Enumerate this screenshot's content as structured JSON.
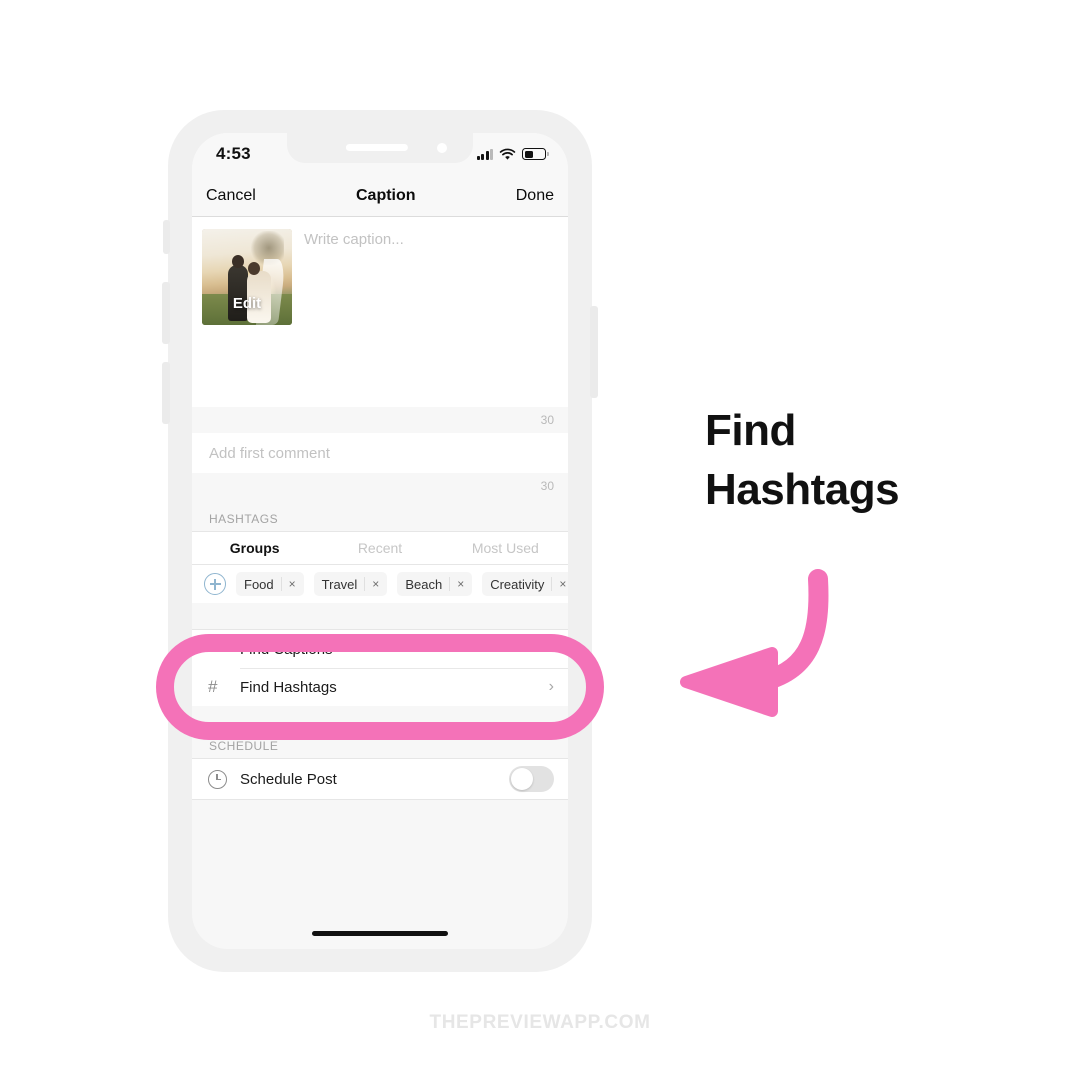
{
  "statusbar": {
    "time": "4:53",
    "signal_icon": "cellular-signal-icon",
    "wifi_icon": "wifi-icon",
    "battery_icon": "battery-icon"
  },
  "navbar": {
    "cancel_label": "Cancel",
    "title": "Caption",
    "done_label": "Done"
  },
  "caption": {
    "placeholder": "Write caption...",
    "thumb_edit_label": "Edit",
    "counter": "30",
    "comment_placeholder": "Add first comment",
    "comment_counter": "30"
  },
  "hashtags": {
    "section_label": "HASHTAGS",
    "tabs": [
      {
        "label": "Groups",
        "active": true
      },
      {
        "label": "Recent",
        "active": false
      },
      {
        "label": "Most Used",
        "active": false
      }
    ],
    "add_icon": "plus-circle-icon",
    "chips": [
      {
        "label": "Food",
        "remove": "×"
      },
      {
        "label": "Travel",
        "remove": "×"
      },
      {
        "label": "Beach",
        "remove": "×"
      },
      {
        "label": "Creativity",
        "remove": "×"
      }
    ]
  },
  "tools": [
    {
      "icon": "lines-icon",
      "label": "Find Captions",
      "chevron": "›"
    },
    {
      "icon": "hash-icon",
      "label": "Find Hashtags",
      "chevron": "›"
    }
  ],
  "schedule": {
    "section_label": "SCHEDULE",
    "icon": "clock-icon",
    "label": "Schedule Post",
    "toggle_state": "off"
  },
  "callout": {
    "line1": "Find",
    "line2": "Hashtags",
    "arrow_icon": "curved-arrow-left-icon",
    "accent_color": "#f472b8"
  },
  "watermark": {
    "text": "THEPREVIEWAPP.COM"
  }
}
